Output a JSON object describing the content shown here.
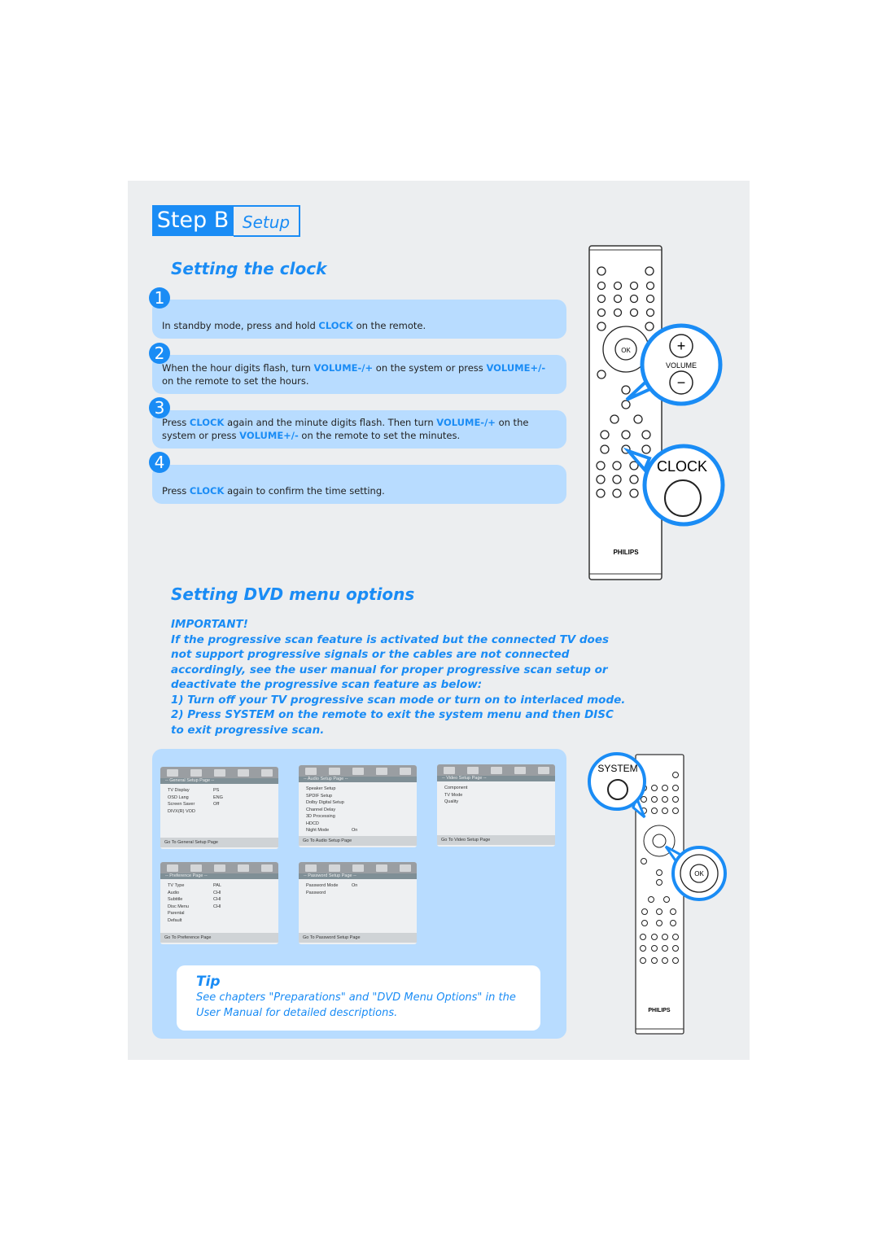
{
  "header": {
    "step": "Step B",
    "section": "Setup"
  },
  "clock": {
    "title": "Setting the clock",
    "steps": [
      {
        "number": "1",
        "segments": [
          {
            "t": "In standby mode, press and hold "
          },
          {
            "t": "CLOCK",
            "hl": true
          },
          {
            "t": " on the remote."
          }
        ]
      },
      {
        "number": "2",
        "segments": [
          {
            "t": "When the hour digits flash, turn "
          },
          {
            "t": "VOLUME-/+",
            "hl": true
          },
          {
            "t": " on the system or press "
          },
          {
            "t": "VOLUME+/-",
            "hl": true
          },
          {
            "t": " on the remote to set the hours."
          }
        ]
      },
      {
        "number": "3",
        "segments": [
          {
            "t": "Press "
          },
          {
            "t": "CLOCK",
            "hl": true
          },
          {
            "t": " again and the minute digits flash. Then turn "
          },
          {
            "t": "VOLUME-/+",
            "hl": true
          },
          {
            "t": " on the system or press "
          },
          {
            "t": "VOLUME+/-",
            "hl": true
          },
          {
            "t": " on the remote to set the minutes."
          }
        ]
      },
      {
        "number": "4",
        "segments": [
          {
            "t": "Press "
          },
          {
            "t": "CLOCK",
            "hl": true
          },
          {
            "t": " again to confirm the time setting."
          }
        ]
      }
    ]
  },
  "remote": {
    "brand": "PHILIPS",
    "ok": "OK",
    "volume_label": "VOLUME",
    "clock_label": "CLOCK",
    "system_label": "SYSTEM"
  },
  "dvd": {
    "title": "Setting DVD menu options",
    "important_heading": "IMPORTANT!",
    "important_text": "If the progressive scan feature is activated but the connected TV does not support progressive signals or the cables are not connected accordingly, see the user manual for proper progressive scan setup or deactivate the progressive scan feature as below:",
    "item1": "1) Turn off your TV progressive scan mode or turn on to interlaced mode.",
    "item2": "2) Press SYSTEM on the remote to exit the system menu and then DISC to exit progressive scan.",
    "menus": [
      {
        "title": "-- General Setup Page --",
        "rows": [
          [
            "TV Display",
            "PS"
          ],
          [
            "OSD Lang",
            "ENG"
          ],
          [
            "Screen Saver",
            "Off"
          ],
          [
            "DIVX(R) VOD",
            ""
          ]
        ],
        "footer": "Go To General Setup Page"
      },
      {
        "title": "-- Audio Setup Page --",
        "rows": [
          [
            "Speaker Setup",
            ""
          ],
          [
            "SPDIF Setup",
            ""
          ],
          [
            "Dolby Digital Setup",
            ""
          ],
          [
            "Channel Delay",
            ""
          ],
          [
            "3D Processing",
            ""
          ],
          [
            "HDCD",
            ""
          ],
          [
            "Night Mode",
            "On"
          ]
        ],
        "footer": "Go To Audio Setup Page"
      },
      {
        "title": "-- Video Setup Page --",
        "rows": [
          [
            "Component",
            ""
          ],
          [
            "TV Mode",
            ""
          ],
          [
            "Quality",
            ""
          ]
        ],
        "footer": "Go To Video Setup Page"
      },
      {
        "title": "-- Preference Page --",
        "rows": [
          [
            "TV Type",
            "PAL"
          ],
          [
            "Audio",
            "CHI"
          ],
          [
            "Subtitle",
            "CHI"
          ],
          [
            "Disc Menu",
            "CHI"
          ],
          [
            "Parental",
            ""
          ],
          [
            "Default",
            ""
          ]
        ],
        "footer": "Go To Preference Page"
      },
      {
        "title": "-- Password Setup Page --",
        "rows": [
          [
            "Password Mode",
            "On"
          ],
          [
            "Password",
            ""
          ]
        ],
        "footer": "Go To Password Setup Page"
      }
    ],
    "tip": {
      "title": "Tip",
      "text": "See chapters \"Preparations\" and \"DVD Menu Options\" in the User Manual for detailed descriptions."
    }
  },
  "colors": {
    "accent": "#1a8cf5",
    "box": "#b8dcff",
    "panel": "#eceef0"
  }
}
